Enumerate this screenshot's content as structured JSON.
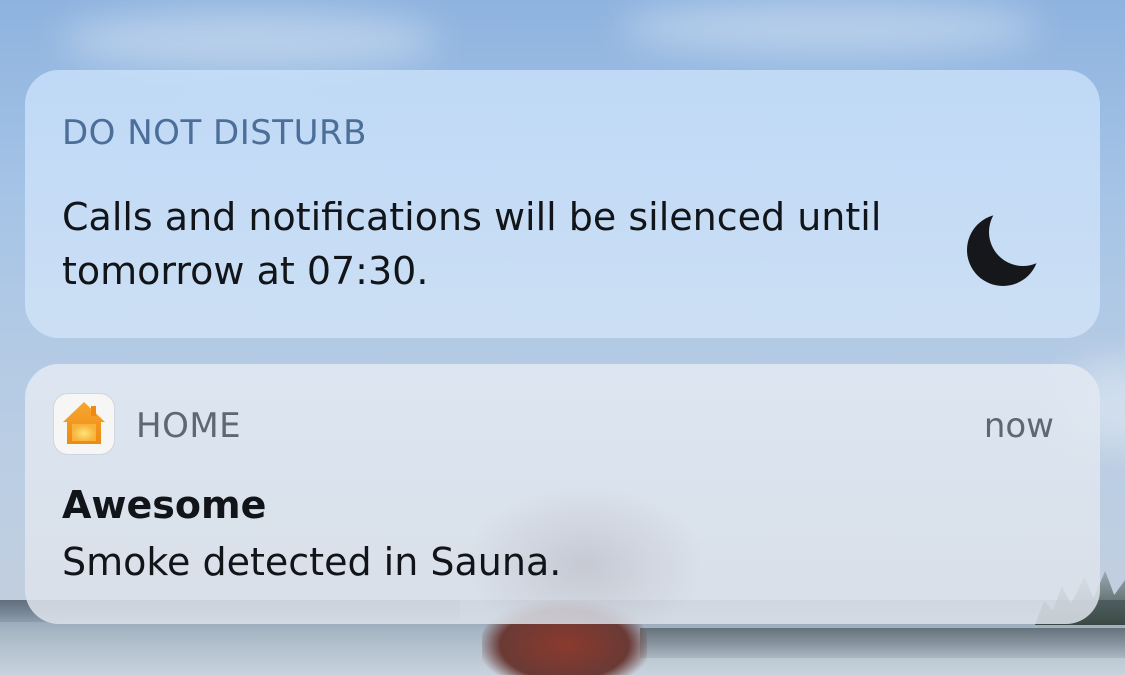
{
  "dnd_notification": {
    "header": "DO NOT DISTURB",
    "message": "Calls and notifications will be silenced until tomorrow at 07:30.",
    "icon": "moon-icon"
  },
  "home_notification": {
    "app_name": "HOME",
    "app_icon": "home-app-icon",
    "timestamp": "now",
    "title": "Awesome",
    "body": "Smoke detected in Sauna."
  },
  "colors": {
    "dnd_header": "#4c6f9a",
    "text_primary": "#111418",
    "text_secondary": "#5f6771",
    "home_icon_orange": "#f39a1e"
  }
}
